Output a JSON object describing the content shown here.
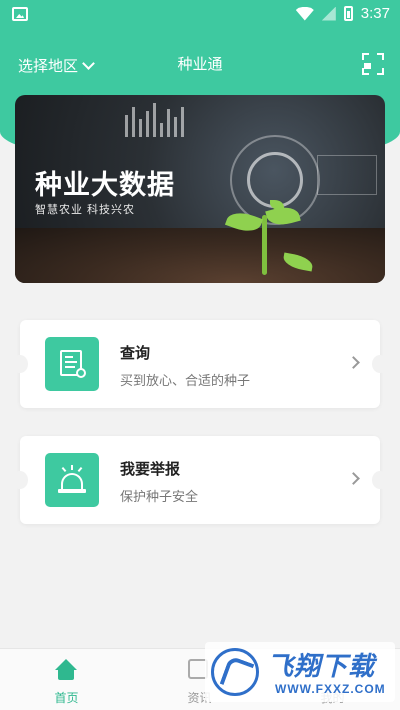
{
  "status_bar": {
    "time": "3:37"
  },
  "nav": {
    "region_label": "选择地区",
    "title": "种业通"
  },
  "banner": {
    "title": "种业大数据",
    "subtitle": "智慧农业  科技兴农"
  },
  "cards": [
    {
      "title": "查询",
      "subtitle": "买到放心、合适的种子",
      "icon": "document-search-icon"
    },
    {
      "title": "我要举报",
      "subtitle": "保护种子安全",
      "icon": "alarm-icon"
    }
  ],
  "tabs": [
    {
      "label": "首页",
      "icon": "home-icon",
      "active": true
    },
    {
      "label": "资讯",
      "icon": "news-icon",
      "active": false
    },
    {
      "label": "我的",
      "icon": "profile-icon",
      "active": false
    }
  ],
  "watermark": {
    "text": "飞翔下载",
    "url": "WWW.FXXZ.COM"
  },
  "colors": {
    "accent": "#3ec9a0",
    "tab_active": "#2fb88f",
    "watermark": "#2f6fc9"
  }
}
